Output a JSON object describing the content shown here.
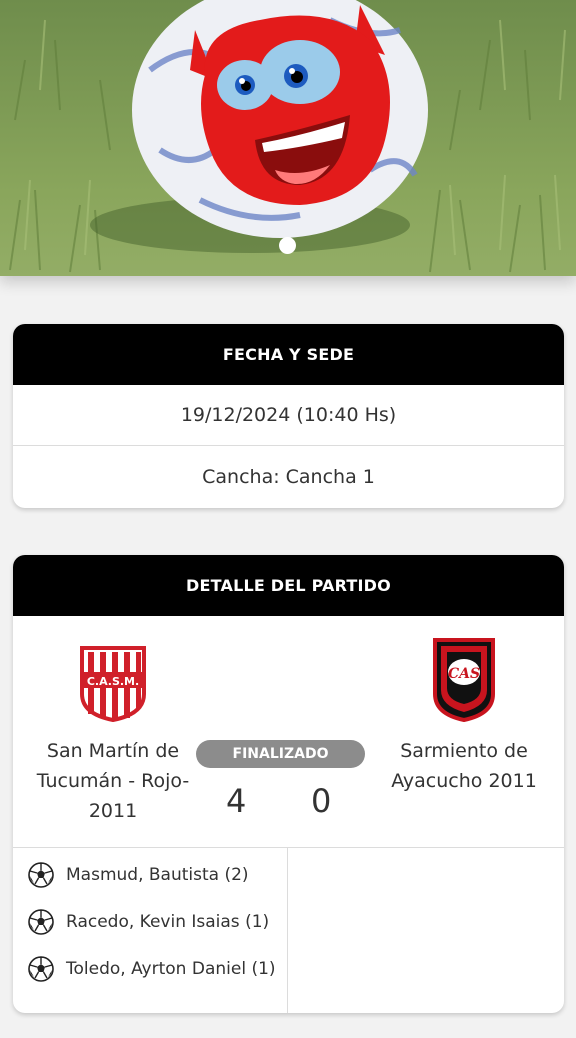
{
  "hero": {
    "image_icon": "soccer-ball-mascot-photo",
    "colors": {
      "grass": "#7e9b55",
      "mascot": "#e61e1e"
    }
  },
  "fecha_card": {
    "title": "FECHA Y SEDE",
    "datetime": "19/12/2024 (10:40 Hs)",
    "venue": "Cancha: Cancha 1"
  },
  "detalle_card": {
    "title": "DETALLE DEL PARTIDO",
    "status": "FINALIZADO",
    "home": {
      "name": "San Martín de Tucumán - Rojo- 2011",
      "logo_text": "C.A.S.M.",
      "score": "4"
    },
    "away": {
      "name": "Sarmiento de Ayacucho 2011",
      "logo_text": "CAS",
      "score": "0"
    },
    "home_scorers": [
      {
        "name": "Masmud, Bautista (2)",
        "icon": "soccer-ball-icon"
      },
      {
        "name": "Racedo, Kevin Isaias (1)",
        "icon": "soccer-ball-icon"
      },
      {
        "name": "Toledo, Ayrton Daniel (1)",
        "icon": "soccer-ball-icon"
      }
    ],
    "away_scorers": []
  }
}
